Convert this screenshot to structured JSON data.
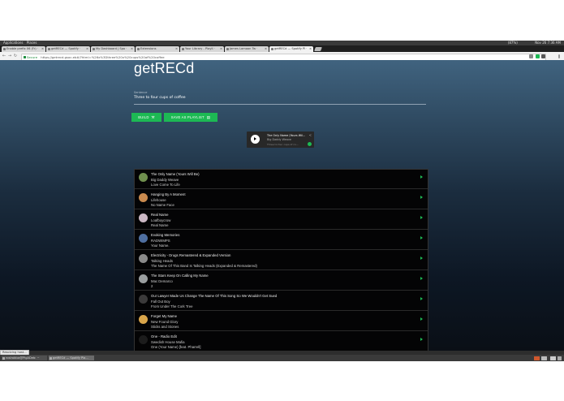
{
  "os": {
    "applications_label": "Applications",
    "places_label": "Places",
    "status_left": "(87%)",
    "datetime": "Nov 26 7:36 AM"
  },
  "browser": {
    "tabs": [
      {
        "label": "Enable prefix 06 (Fr) ·",
        "active": false
      },
      {
        "label": "getRECd — Spotify ·",
        "active": false
      },
      {
        "label": "My Dashboard | Spo ·",
        "active": false
      },
      {
        "label": "Extensions",
        "active": false
      },
      {
        "label": "Your Library - Playli ·",
        "active": false
      },
      {
        "label": "James Lamoon Tw ·",
        "active": false
      },
      {
        "label": "getRECd — Spotify Pl ·",
        "active": true
      }
    ],
    "secure_label": "Secure",
    "url": "https://getrecd.gsoc.eb#/?html=%26x%3Dthree%20x%20cups%20of%20coffee"
  },
  "app": {
    "title": "getRECd",
    "sentence_label": "Sentence",
    "sentence_value": "Three to four cups of coffee",
    "build_label": "BUILD",
    "save_label": "SAVE AS PLAYLIST",
    "build_icon": "wrench-icon",
    "save_icon": "playlist-save-icon",
    "player": {
      "track": "The Only Name (Yours Wil...",
      "artist": "Big Daddy Weave",
      "playlist": "Three to four cups of co..."
    },
    "tracks": [
      {
        "title": "The Only Name (Yours Will Be)",
        "artist": "Big Daddy Weave",
        "album": "Love Come To Life",
        "color": "#6f8f4e"
      },
      {
        "title": "Hanging By A Moment",
        "artist": "Lifehouse",
        "album": "No Name Face",
        "color": "#c98a4e"
      },
      {
        "title": "Real Name",
        "artist": "Loafboycrow",
        "album": "Real Name",
        "color": "#cbb8c4"
      },
      {
        "title": "Evoking Memories",
        "artist": "RADWIMPS",
        "album": "Your Name.",
        "color": "#4f6fa0"
      },
      {
        "title": "Electricity - Drugs Remastered & Expanded Version",
        "artist": "Talking Heads",
        "album": "The Name Of This Band Is Talking Heads (Expanded & Remastered)",
        "color": "#8a8a8a"
      },
      {
        "title": "The Stars Keep On Calling My Name",
        "artist": "Mac Demarco",
        "album": "2",
        "color": "#9a9e9f"
      },
      {
        "title": "Our Lawyer Made Us Change The Name Of This Song So We Wouldn't Get Sued",
        "artist": "Fall Out Boy",
        "album": "From Under The Cork Tree",
        "color": "#3b3a3a"
      },
      {
        "title": "Forget My Name",
        "artist": "New Found Glory",
        "album": "Sticks and Stones",
        "color": "#d9a54a"
      },
      {
        "title": "One - Radio Edit",
        "artist": "Swedish House Mafia",
        "album": "One (Your Name) [feat. Pharrell]",
        "color": "#1c1c1c"
      }
    ]
  },
  "status_text": "Resolving host...",
  "taskbar": {
    "items": [
      {
        "label": "rosiroblox@PigADeb: ~"
      },
      {
        "label": "getRECd — Spotify Pla..."
      }
    ]
  }
}
